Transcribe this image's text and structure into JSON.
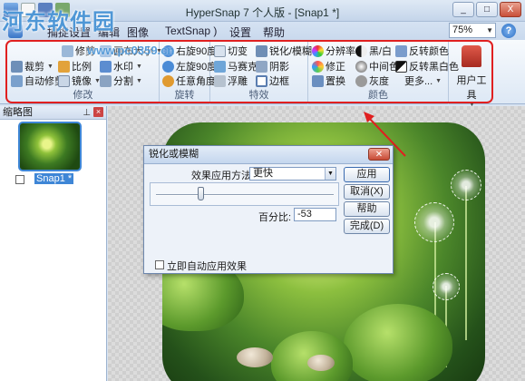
{
  "window": {
    "title": "HyperSnap 7 个人版 - [Snap1 *]",
    "buttons": [
      "_",
      "□",
      "X"
    ]
  },
  "watermark": {
    "text": "河东软件园",
    "url": "www.pc0359.cn"
  },
  "tabs": [
    {
      "label": "捕捉设置"
    },
    {
      "label": "编辑"
    },
    {
      "label": "图像"
    },
    {
      "label": "TextSnap )"
    },
    {
      "label": "设置"
    },
    {
      "label": "帮助"
    }
  ],
  "zoom": {
    "value": "75%"
  },
  "ribbon": {
    "groups": [
      {
        "label": "修改",
        "items": [
          {
            "label": "裁剪"
          },
          {
            "label": "比例"
          },
          {
            "label": "水印"
          },
          {
            "label": "自动修剪"
          },
          {
            "label": "镜像"
          },
          {
            "label": "分割"
          },
          {
            "label": "修剪"
          },
          {
            "label": "画布大小"
          }
        ]
      },
      {
        "label": "旋转",
        "items": [
          {
            "label": "右旋90度"
          },
          {
            "label": "左旋90度"
          },
          {
            "label": "任意角度"
          }
        ]
      },
      {
        "label": "特效",
        "items": [
          {
            "label": "切变"
          },
          {
            "label": "锐化/模糊"
          },
          {
            "label": "马赛克"
          },
          {
            "label": "阴影"
          },
          {
            "label": "浮雕"
          },
          {
            "label": "边框"
          }
        ]
      },
      {
        "label": "颜色",
        "items": [
          {
            "label": "分辨率"
          },
          {
            "label": "黑/白"
          },
          {
            "label": "反转颜色"
          },
          {
            "label": "修正"
          },
          {
            "label": "中间色"
          },
          {
            "label": "反转黑白色"
          },
          {
            "label": "置换"
          },
          {
            "label": "灰度"
          },
          {
            "label": "更多..."
          }
        ]
      }
    ],
    "user_tools": {
      "label": "用户工具"
    }
  },
  "thumbnails": {
    "title": "缩略图",
    "items": [
      {
        "label": "Snap1 *"
      }
    ]
  },
  "dialog": {
    "title": "锐化或模糊",
    "method_label": "效果应用方法:",
    "method_value": "更快",
    "slider_value": -53,
    "percent_label": "百分比:",
    "percent_value": "-53",
    "buttons": {
      "apply": "应用",
      "cancel": "取消(X)",
      "help": "帮助",
      "done": "完成(D)"
    },
    "checkbox_label": "立即自动应用效果"
  },
  "colors": {
    "accent": "#3e86d6",
    "annotation": "#e02020",
    "ribbon_bg": "#dde8f5"
  }
}
